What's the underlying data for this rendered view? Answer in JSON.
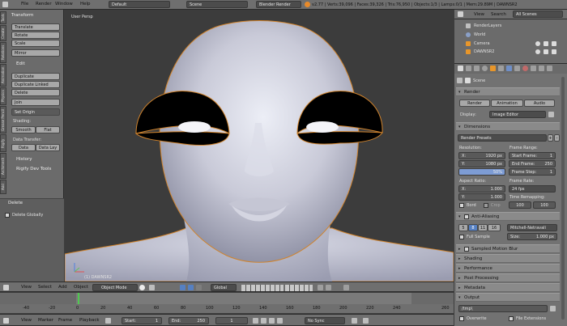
{
  "topbar": {
    "menus": [
      "File",
      "Render",
      "Window",
      "Help"
    ],
    "layout": "Default",
    "scene": "Scene",
    "engine": "Blender Render",
    "stats": "v2.77 | Verts:39,096 | Faces:39,326 | Tris:76,950 | Objects:1/3 | Lamps:0/1 | Mem:29.89M | DAWNSR2"
  },
  "tool_shelf": {
    "transform_header": "Transform",
    "translate": "Translate",
    "rotate": "Rotate",
    "scale": "Scale",
    "mirror": "Mirror",
    "edit_header": "Edit",
    "duplicate": "Duplicate",
    "duplicate_linked": "Duplicate Linked",
    "delete": "Delete",
    "join": "Join",
    "set_origin": "Set Origin",
    "shading_label": "Shading:",
    "smooth": "Smooth",
    "flat": "Flat",
    "data_transfer_label": "Data Transfer:",
    "data": "Data",
    "data_lay": "Data Lay",
    "history_header": "History",
    "rigify_header": "Rigify Dev Tools",
    "delete_header": "Delete",
    "delete_globally": "Delete Globally",
    "tabs": [
      "Tools",
      "Create",
      "Relations",
      "Animation",
      "Physics",
      "Grease Pencil",
      "Rigify",
      "Archimesh",
      "Add"
    ]
  },
  "viewport": {
    "label": "User Persp",
    "object_label": "(1) DAWNSR2"
  },
  "view3d_header": {
    "menus": [
      "View",
      "Select",
      "Add",
      "Object"
    ],
    "mode": "Object Mode",
    "orientation": "Global"
  },
  "timeline": {
    "ticks": [
      "-40",
      "-20",
      "0",
      "20",
      "40",
      "60",
      "80",
      "100",
      "120",
      "140",
      "160",
      "180",
      "200",
      "220",
      "240",
      "260"
    ],
    "menus": [
      "View",
      "Marker",
      "Frame",
      "Playback"
    ],
    "start_label": "Start:",
    "start_value": "1",
    "end_label": "End:",
    "end_value": "250",
    "current_frame": "1",
    "sync": "No Sync"
  },
  "outliner": {
    "menus": [
      "View",
      "Search"
    ],
    "filter": "All Scenes",
    "items": [
      "RenderLayers",
      "World",
      "Camera",
      "DAWNSR2"
    ]
  },
  "properties": {
    "scene_label": "Scene",
    "render_header": "Render",
    "render_btn": "Render",
    "animation_btn": "Animation",
    "audio_btn": "Audio",
    "display_label": "Display:",
    "display_value": "Image Editor",
    "dimensions_header": "Dimensions",
    "render_presets": "Render Presets",
    "resolution_label": "Resolution:",
    "res_x": "X:",
    "res_x_val": "1920 px",
    "res_y": "Y:",
    "res_y_val": "1080 px",
    "res_pct": "50%",
    "frame_range_label": "Frame Range:",
    "start_frame": "Start Frame:",
    "start_frame_val": "1",
    "end_frame": "End Frame:",
    "end_frame_val": "250",
    "frame_step": "Frame Step:",
    "frame_step_val": "1",
    "aspect_label": "Aspect Ratio:",
    "asp_x": "X:",
    "asp_x_val": "1.000",
    "asp_y": "Y:",
    "asp_y_val": "1.000",
    "frame_rate_label": "Frame Rate:",
    "frame_rate_val": "24 fps",
    "time_remap_label": "Time Remapping:",
    "remap_old": "100",
    "remap_new": "100",
    "border": "Bord",
    "crop": "Crop",
    "aa_header": "Anti-Aliasing",
    "aa_samples": [
      "5",
      "8",
      "11",
      "16"
    ],
    "aa_filter": "Mitchell-Netravali",
    "full_sample": "Full Sample",
    "size_label": "Size:",
    "size_val": "1.000 px",
    "collapsed_panels": [
      "Sampled Motion Blur",
      "Shading",
      "Performance",
      "Post Processing",
      "Metadata"
    ],
    "output_header": "Output",
    "output_path": "/tmp\\",
    "overwrite": "Overwrite",
    "file_extensions": "File Extensions"
  }
}
